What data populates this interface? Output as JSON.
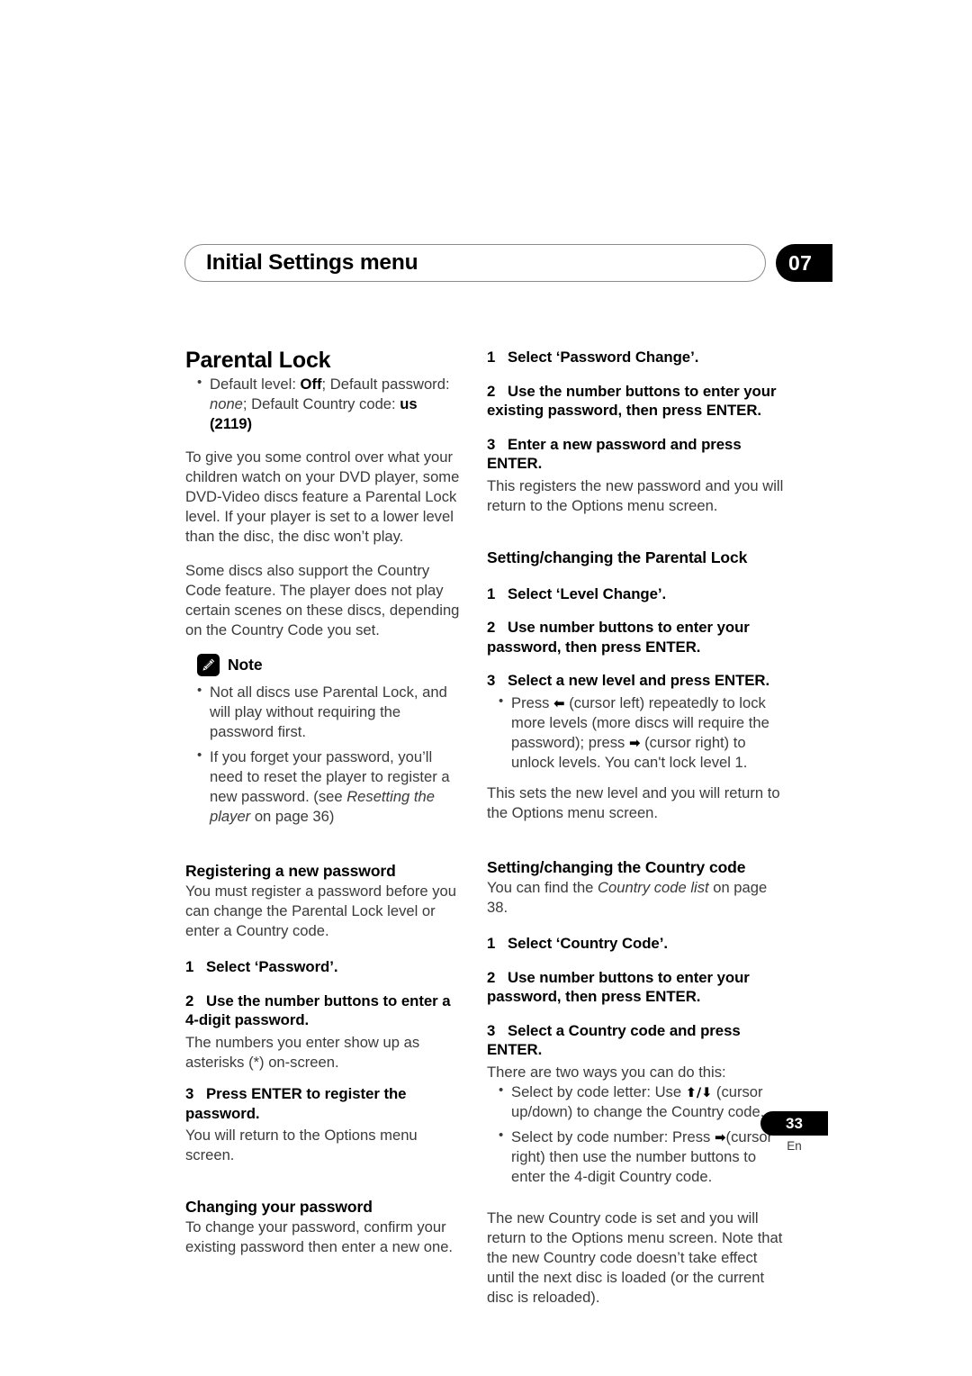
{
  "header": {
    "title": "Initial Settings menu",
    "chapter": "07"
  },
  "left": {
    "section_title": "Parental Lock",
    "defaults_bullet": {
      "prefix": "Default level: ",
      "level": "Off",
      "mid1": "; Default password: ",
      "password": "none",
      "mid2": "; Default Country code: ",
      "country": "us (2119)"
    },
    "intro_p1": "To give you some control over what your children watch on your DVD player, some DVD-Video discs feature a Parental Lock level. If your player is set to a lower level than the disc, the disc won’t play.",
    "intro_p2": "Some discs also support the Country Code feature. The player does not play certain scenes on these discs, depending on the Country Code you set.",
    "note_label": "Note",
    "note_bullets": [
      "Not all discs use Parental Lock, and will play without requiring the password first."
    ],
    "note_bullet2": {
      "pre": "If you forget your password, you’ll need to reset the player to register a new password. (see ",
      "italic": "Resetting the player",
      "post": " on page 36)"
    },
    "registering": {
      "heading": "Registering a new password",
      "intro": "You must register a password before you can change the Parental Lock level or enter a Country code.",
      "steps": [
        {
          "num": "1",
          "text": "Select ‘Password’."
        },
        {
          "num": "2",
          "text": "Use the number buttons to enter a 4-digit password."
        },
        {
          "num": "3",
          "text": "Press ENTER to register the password."
        }
      ],
      "after_step2": "The numbers you enter show up as asterisks (*) on-screen.",
      "after_step3": "You will return to the Options menu screen."
    },
    "changing": {
      "heading": "Changing your password",
      "intro": "To change your password, confirm your existing password then enter a new one."
    }
  },
  "right": {
    "changing_steps": [
      {
        "num": "1",
        "text": "Select ‘Password Change’."
      },
      {
        "num": "2",
        "text": "Use the number buttons to enter your existing password, then press ENTER."
      },
      {
        "num": "3",
        "text": "Enter a new password and press ENTER."
      }
    ],
    "changing_after3": "This registers the new password and you will return to the Options menu screen.",
    "parental": {
      "heading": "Setting/changing the Parental Lock",
      "steps": [
        {
          "num": "1",
          "text": "Select ‘Level Change’."
        },
        {
          "num": "2",
          "text": "Use number buttons to enter your password, then press ENTER."
        },
        {
          "num": "3",
          "text": "Select a new level and press ENTER."
        }
      ],
      "bullet": {
        "p1": "Press ",
        "arrow_left": "⬅",
        "p2": " (cursor left) repeatedly to lock more levels (more discs will require the password); press ",
        "arrow_right": "➡",
        "p3": " (cursor right) to unlock levels. You can't lock level 1."
      },
      "after": "This sets the new level and you will return to the Options menu screen."
    },
    "country": {
      "heading": "Setting/changing the Country code",
      "intro_pre": "You can find the ",
      "intro_italic": "Country code list",
      "intro_post": " on page 38.",
      "steps": [
        {
          "num": "1",
          "text": "Select ‘Country Code’."
        },
        {
          "num": "2",
          "text": "Use number buttons to enter your password, then press ENTER."
        },
        {
          "num": "3",
          "text": "Select a Country code and press ENTER."
        }
      ],
      "after_step3": "There are two ways you can do this:",
      "bullet_letter": {
        "pre": "Select by code letter: Use ",
        "up": "⬆",
        "slash": "/",
        "down": "⬇",
        "post": " (cursor up/down) to change the Country code."
      },
      "bullet_number": {
        "pre": "Select by code number: Press ",
        "arrow_right": "➡",
        "post": "(cursor right) then use the number buttons to enter the 4-digit Country code."
      },
      "closing": "The new Country code is set and you will return to the Options menu screen. Note that the new Country code doesn’t take effect until the next disc is loaded (or the current disc is reloaded)."
    }
  },
  "footer": {
    "page_number": "33",
    "language": "En"
  }
}
